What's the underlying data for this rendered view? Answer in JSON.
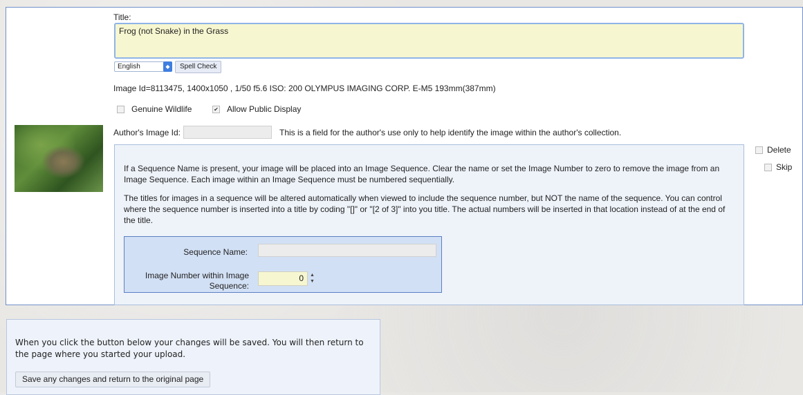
{
  "form": {
    "title_label": "Title:",
    "title_value": "Frog (not Snake) in the Grass",
    "language_value": "English",
    "spell_check_label": "Spell Check",
    "image_info": "Image Id=8113475, 1400x1050 , 1/50 f5.6 ISO: 200 OLYMPUS IMAGING CORP. E-M5 193mm(387mm)",
    "genuine_wildlife_label": "Genuine Wildlife",
    "allow_public_label": "Allow Public Display",
    "author_image_id_label": "Author's Image Id:",
    "author_image_id_value": "",
    "author_help": "This is a field for the author's use only to help identify the image within the author's collection."
  },
  "sequence": {
    "p1": "If a Sequence Name is present, your image will be placed into an Image Sequence. Clear the name or set the Image Number to zero to remove the image from an Image Sequence. Each image within an Image Sequence must be numbered sequentially.",
    "p2": "The titles for images in a sequence will be altered automatically when viewed to include the sequence number, but NOT the name of the sequence. You can control where the sequence number is inserted into a title by coding \"[]\" or \"[2 of 3]\" into you title. The actual numbers will be inserted in that location instead of at the end of the title.",
    "name_label": "Sequence Name:",
    "name_value": "",
    "number_label": "Image Number within Image Sequence:",
    "number_value": "0"
  },
  "side": {
    "delete_label": "Delete",
    "skip_label": "Skip"
  },
  "bottom": {
    "text": "When you click the button below your changes will be saved. You will then return to the page where you started your upload.",
    "save_label": "Save any changes and return to the original page"
  }
}
